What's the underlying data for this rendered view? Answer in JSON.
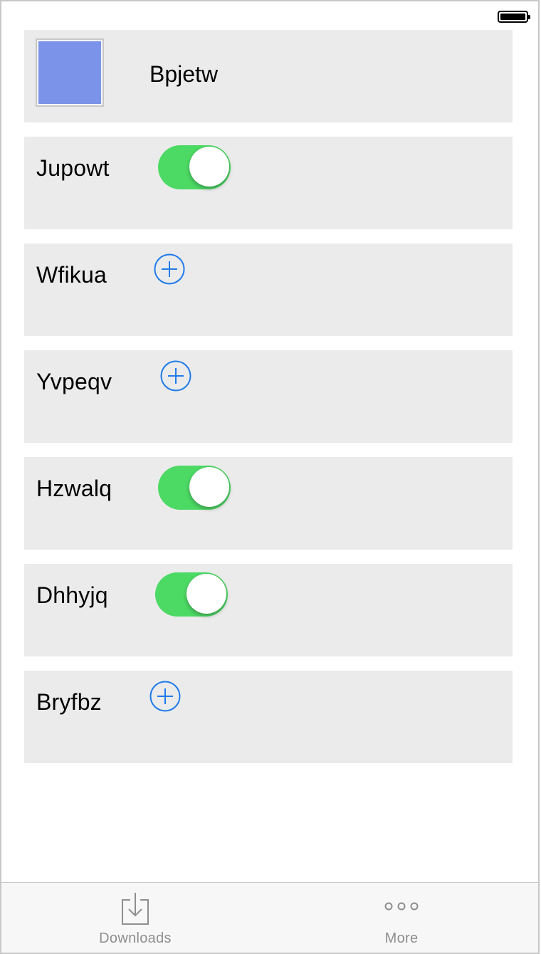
{
  "colors": {
    "row_bg": "#ebebeb",
    "toggle_on": "#4cd964",
    "accent_blue": "#1e7bea",
    "thumbnail_swatch": "#7b93e8",
    "tab_inactive": "#8e8e8e"
  },
  "header_row": {
    "label": "Bpjetw",
    "thumbnail": "image-thumbnail"
  },
  "rows": [
    {
      "label": "Jupowt",
      "control": "toggle",
      "state": "on"
    },
    {
      "label": "Wfikua",
      "control": "add-button",
      "icon": "plus-circle-icon"
    },
    {
      "label": "Yvpeqv",
      "control": "add-button",
      "icon": "plus-circle-icon"
    },
    {
      "label": "Hzwalq",
      "control": "toggle",
      "state": "on"
    },
    {
      "label": "Dhhyjq",
      "control": "toggle",
      "state": "on"
    },
    {
      "label": "Bryfbz",
      "control": "add-button",
      "icon": "plus-circle-icon"
    }
  ],
  "tab_bar": {
    "tabs": [
      {
        "label": "Downloads",
        "icon": "download-icon"
      },
      {
        "label": "More",
        "icon": "more-icon"
      }
    ]
  }
}
